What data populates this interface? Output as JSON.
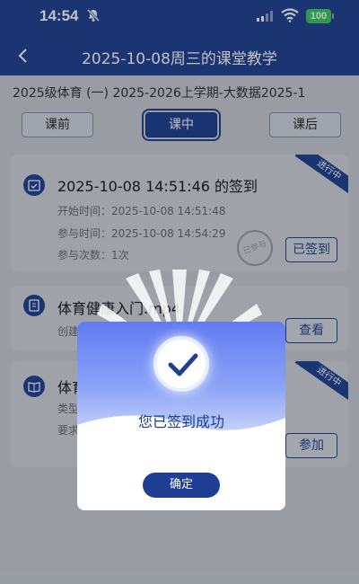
{
  "status_bar": {
    "time": "14:54",
    "battery": "100"
  },
  "nav": {
    "title": "2025-10-08周三的课堂教学"
  },
  "course": {
    "line": "2025级体育 (一) 2025-2026上学期-大数据2025-1"
  },
  "tabs": [
    {
      "label": "课前"
    },
    {
      "label": "课中"
    },
    {
      "label": "课后"
    }
  ],
  "cards": [
    {
      "title": "2025-10-08 14:51:46 的签到",
      "ribbon": "进行中",
      "meta": [
        "开始时间：2025-10-08 14:51:48",
        "参与时间：2025-10-08 14:54:29",
        "参与次数：1次"
      ],
      "stamp": "已参与",
      "button": "已签到"
    },
    {
      "title": "体育健康入门.mp4",
      "meta": [
        "创建"
      ],
      "button": "查看"
    },
    {
      "title": "体育",
      "ribbon": "进行中",
      "meta": [
        "类型",
        "要求"
      ],
      "button": "参加"
    }
  ],
  "modal": {
    "message": "您已签到成功",
    "ok_label": "确定"
  },
  "colors": {
    "primary": "#1b3d8f",
    "battery": "#39c75f",
    "modal_gradient_top": "#5f7bf0"
  }
}
